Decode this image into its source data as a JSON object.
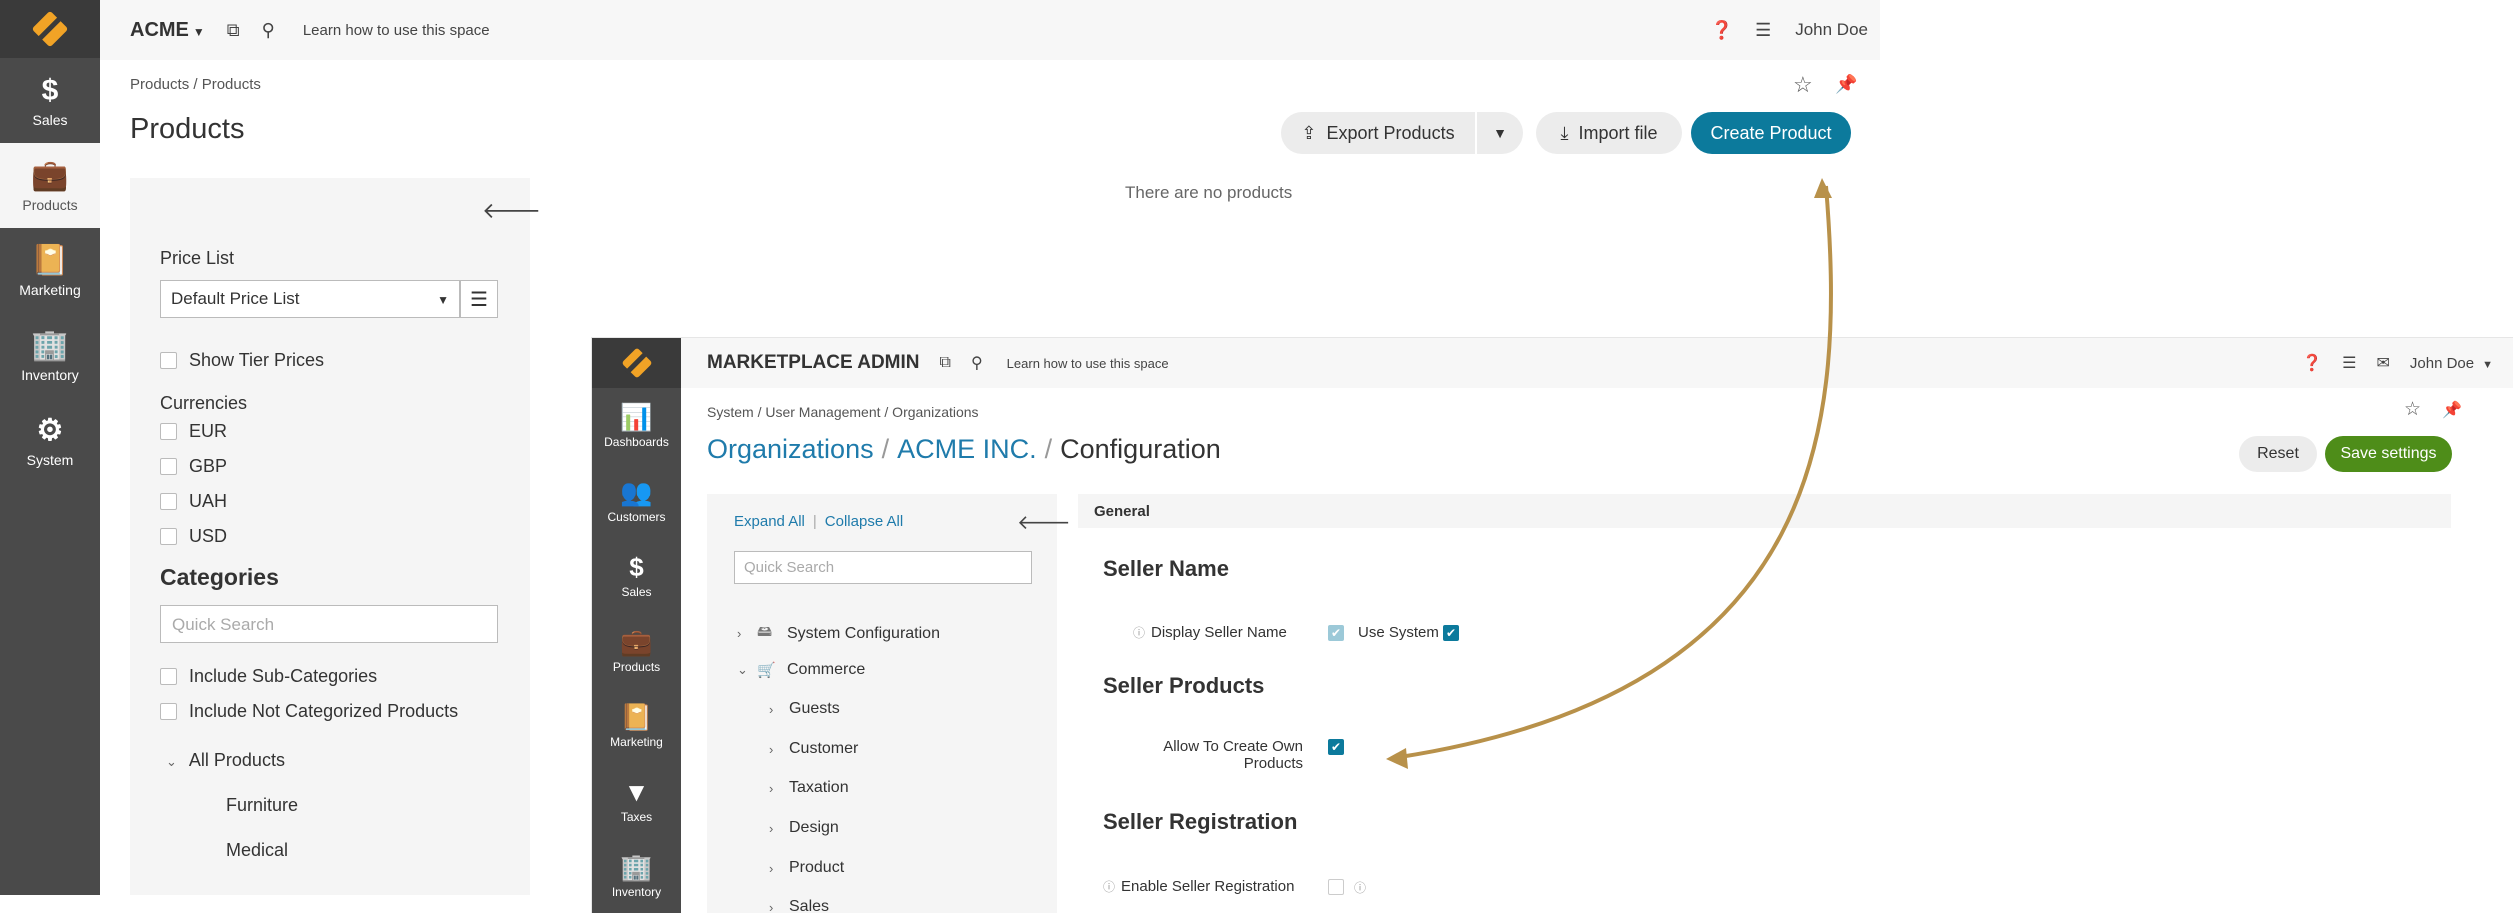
{
  "back_window": {
    "sidebar": [
      {
        "label": "Sales",
        "icon": "dollar-icon",
        "glyph": "$"
      },
      {
        "label": "Products",
        "icon": "briefcase-icon",
        "glyph": "💼"
      },
      {
        "label": "Marketing",
        "icon": "book-icon",
        "glyph": "📔"
      },
      {
        "label": "Inventory",
        "icon": "building-icon",
        "glyph": "🏢"
      },
      {
        "label": "System",
        "icon": "gear-icon",
        "glyph": "⚙"
      }
    ],
    "org_name": "ACME",
    "learn_link": "Learn how to use this space",
    "user_name": "John Doe",
    "breadcrumb": "Products / Products",
    "page_title": "Products",
    "buttons": {
      "export": "Export Products",
      "import": "Import file",
      "create": "Create Product"
    },
    "empty_message": "There are no products",
    "filters": {
      "price_list_label": "Price List",
      "price_list_value": "Default Price List",
      "show_tier_prices": "Show Tier Prices",
      "currencies_label": "Currencies",
      "currencies": [
        "EUR",
        "GBP",
        "UAH",
        "USD"
      ],
      "categories_label": "Categories",
      "quick_search_placeholder": "Quick Search",
      "include_sub": "Include Sub-Categories",
      "include_not_categorized": "Include Not Categorized Products",
      "tree_root": "All Products",
      "tree_children": [
        "Furniture",
        "Medical"
      ]
    }
  },
  "front_window": {
    "sidebar": [
      {
        "label": "Dashboards",
        "icon": "chart-icon",
        "glyph": "📊"
      },
      {
        "label": "Customers",
        "icon": "users-icon",
        "glyph": "👥"
      },
      {
        "label": "Sales",
        "icon": "dollar-icon",
        "glyph": "$"
      },
      {
        "label": "Products",
        "icon": "briefcase-icon",
        "glyph": "💼"
      },
      {
        "label": "Marketing",
        "icon": "book-icon",
        "glyph": "📔"
      },
      {
        "label": "Taxes",
        "icon": "filter-icon",
        "glyph": "▼"
      },
      {
        "label": "Inventory",
        "icon": "building-icon",
        "glyph": "🏢"
      }
    ],
    "org_name": "MARKETPLACE ADMIN",
    "learn_link": "Learn how to use this space",
    "user_name": "John Doe",
    "breadcrumb": "System / User Management / Organizations",
    "title_parts": {
      "organizations": "Organizations",
      "acme": "ACME INC.",
      "configuration": "Configuration"
    },
    "buttons": {
      "reset": "Reset",
      "save": "Save settings"
    },
    "tree": {
      "expand_all": "Expand All",
      "collapse_all": "Collapse All",
      "quick_search_placeholder": "Quick Search",
      "nodes": [
        {
          "label": "System Configuration",
          "level": 0,
          "expanded": false
        },
        {
          "label": "Commerce",
          "level": 0,
          "expanded": true
        },
        {
          "label": "Guests",
          "level": 1,
          "expanded": false
        },
        {
          "label": "Customer",
          "level": 1,
          "expanded": false
        },
        {
          "label": "Taxation",
          "level": 1,
          "expanded": false
        },
        {
          "label": "Design",
          "level": 1,
          "expanded": false
        },
        {
          "label": "Product",
          "level": 1,
          "expanded": false
        },
        {
          "label": "Sales",
          "level": 1,
          "expanded": false
        }
      ]
    },
    "config": {
      "group": "General",
      "seller_name_title": "Seller Name",
      "display_seller_name": "Display Seller Name",
      "use_system": "Use System",
      "seller_products_title": "Seller Products",
      "allow_create_line1": "Allow To Create Own",
      "allow_create_line2": "Products",
      "seller_registration_title": "Seller Registration",
      "enable_seller_registration": "Enable Seller Registration"
    }
  },
  "colors": {
    "accent_blue": "#0c7a9c",
    "save_green": "#4e8d19",
    "arrow_gold": "#b8914a",
    "logo_orange": "#f1a326"
  }
}
